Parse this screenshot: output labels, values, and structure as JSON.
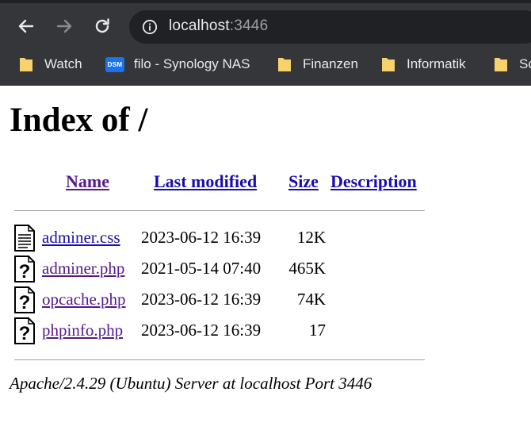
{
  "browser": {
    "url_host": "localhost",
    "url_port": ":3446",
    "bookmarks": [
      {
        "label": "Watch",
        "icon": "folder-icon"
      },
      {
        "label": "filo - Synology NAS",
        "icon": "dsm-icon",
        "icon_text": "DSM"
      },
      {
        "label": "Finanzen",
        "icon": "folder-icon"
      },
      {
        "label": "Informatik",
        "icon": "folder-icon"
      },
      {
        "label": "Sc",
        "icon": "folder-icon"
      }
    ]
  },
  "page": {
    "title": "Index of /",
    "columns": {
      "name": "Name",
      "last_modified": "Last modified",
      "size": "Size",
      "description": "Description"
    },
    "files": [
      {
        "name": "adminer.css",
        "modified": "2023-06-12 16:39",
        "size": "12K",
        "icon": "text-file-icon",
        "visited": false
      },
      {
        "name": "adminer.php",
        "modified": "2021-05-14 07:40",
        "size": "465K",
        "icon": "unknown-file-icon",
        "visited": true
      },
      {
        "name": "opcache.php",
        "modified": "2023-06-12 16:39",
        "size": "74K",
        "icon": "unknown-file-icon",
        "visited": true
      },
      {
        "name": "phpinfo.php",
        "modified": "2023-06-12 16:39",
        "size": "17",
        "icon": "unknown-file-icon",
        "visited": true
      }
    ],
    "footer": "Apache/2.4.29 (Ubuntu) Server at localhost Port 3446"
  },
  "colors": {
    "chrome_bg": "#35363a",
    "omnibox_bg": "#202124",
    "link": "#1a0dab",
    "visited_link": "#551a8b",
    "folder": "#f6d16c"
  }
}
